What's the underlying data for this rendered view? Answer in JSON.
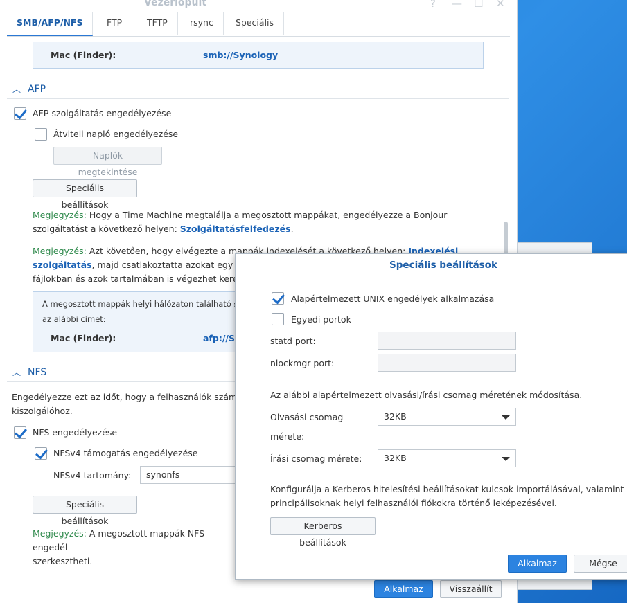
{
  "window": {
    "title": "Vezérlőpult",
    "controls": [
      "?",
      "—",
      "☐",
      "✕"
    ]
  },
  "tabs": [
    {
      "label": "SMB/AFP/NFS",
      "active": true
    },
    {
      "label": "FTP"
    },
    {
      "label": "TFTP"
    },
    {
      "label": "rsync"
    },
    {
      "label": "Speciális"
    }
  ],
  "smb_box": {
    "mac_label": "Mac (Finder):",
    "mac_value": "smb://Synology"
  },
  "afp": {
    "heading": "AFP",
    "enable_label": "AFP-szolgáltatás engedélyezése",
    "transfer_log_label": "Átviteli napló engedélyezése",
    "view_logs_button": "Naplók megtekintése",
    "advanced_button": "Speciális beállítások",
    "note1_prefix": "Megjegyzés:",
    "note1_text": " Hogy a Time Machine megtalálja a megosztott mappákat, engedélyezze a Bonjour szolgáltatást a következő helyen: ",
    "note1_link": "Szolgáltatásfelfedezés",
    "note1_end": ".",
    "note2_prefix": "Megjegyzés:",
    "note2_text": " Azt követően, hogy elvégezte a mappák indexelését a következő helyen: ",
    "note2_link": "Indexelési szolgáltatás",
    "note2_text2": ", majd csatlakoztatta azokat egy M",
    "note2_line3": "fájlokban és azok tartalmában is végezhet keres",
    "box_line1": "A megosztott mappák helyi hálózaton található sza",
    "box_line2": "az alábbi címet:",
    "box_mac_label": "Mac (Finder):",
    "box_mac_value": "afp://S"
  },
  "nfs": {
    "heading": "NFS",
    "desc_line1": "Engedélyezze ezt az időt, hogy a felhasználók számár",
    "desc_line2": "kiszolgálóhoz.",
    "enable_label": "NFS engedélyezése",
    "v4_label": "NFSv4 támogatás engedélyezése",
    "v4_domain_label": "NFSv4 tartomány:",
    "v4_domain_value": "synonfs",
    "advanced_button": "Speciális beállítások",
    "note_prefix": "Megjegyzés:",
    "note_text": " A megosztott mappák NFS engedél",
    "note_line2": "szerkesztheti."
  },
  "footer": {
    "apply": "Alkalmaz",
    "reset": "Visszaállít"
  },
  "modal": {
    "title": "Speciális beállítások",
    "unix_perms_label": "Alapértelmezett UNIX engedélyek alkalmazása",
    "custom_ports_label": "Egyedi portok",
    "statd_label": "statd port:",
    "statd_value": "",
    "nlockmgr_label": "nlockmgr port:",
    "nlockmgr_value": "",
    "packet_desc": "Az alábbi alapértelmezett olvasási/írási csomag méretének módosítása.",
    "read_label_1": "Olvasási csomag",
    "read_label_2": "mérete:",
    "read_value": "32KB",
    "write_label": "Írási csomag mérete:",
    "write_value": "32KB",
    "kerberos_desc_1": "Konfigurálja a Kerberos hitelesítési beállításokat kulcsok importálásával, valamint",
    "kerberos_desc_2": "principálisoknak helyi felhasználói fiókokra történő leképezésével.",
    "kerberos_button": "Kerberos beállítások",
    "apply": "Alkalmaz",
    "cancel": "Mégse"
  }
}
